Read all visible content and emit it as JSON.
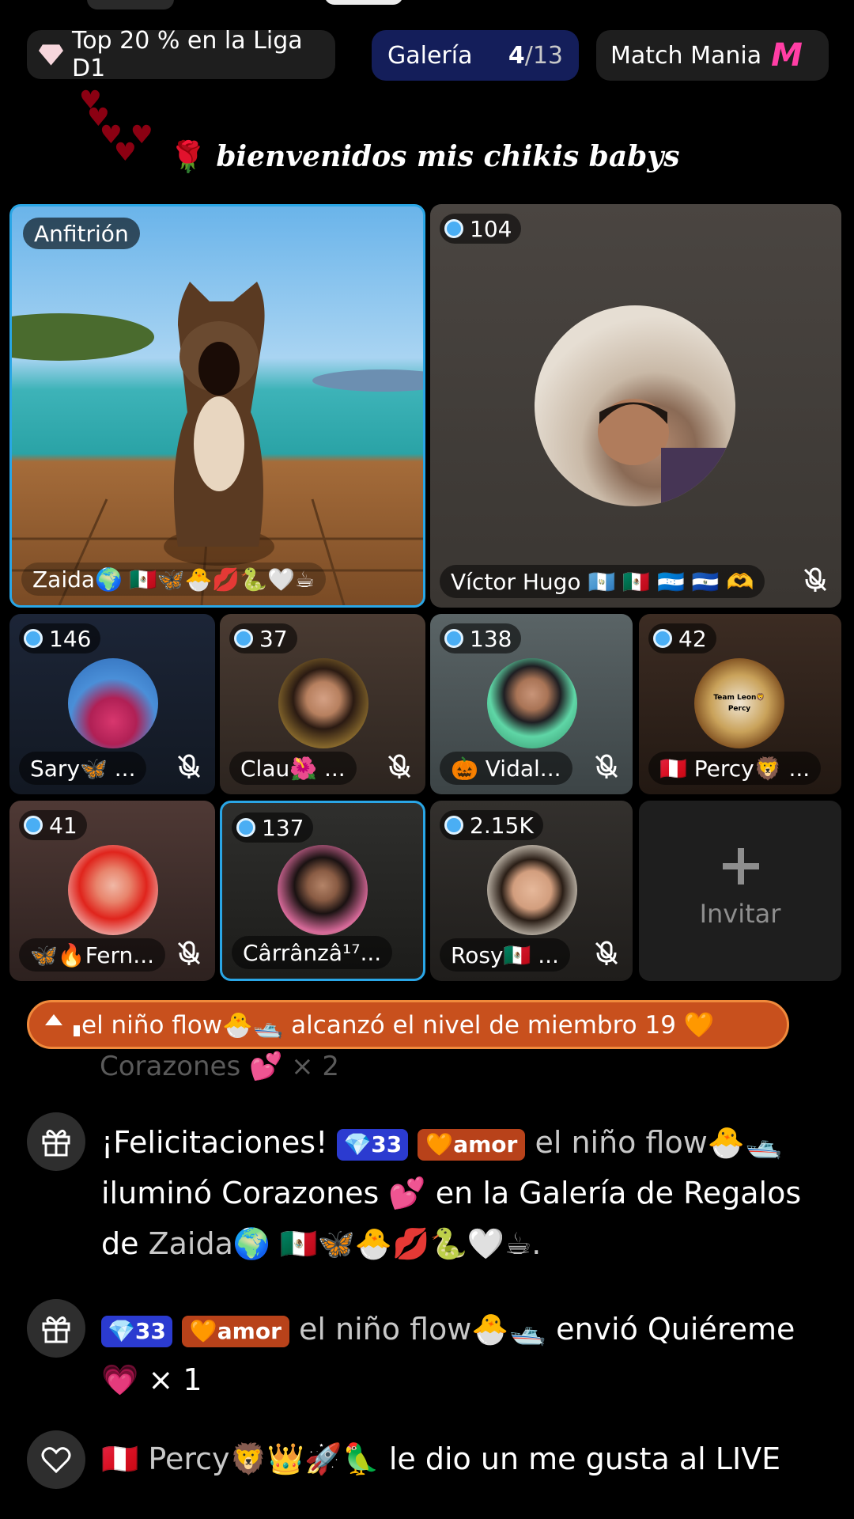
{
  "league": {
    "icon": "diamond-icon",
    "label": "Top 20 % en la Liga D1"
  },
  "gallery": {
    "label": "Galería",
    "current": "4",
    "total": "/13"
  },
  "match_mania": {
    "label": "Match Mania",
    "logo": "M"
  },
  "welcome": {
    "text": "bienvenidos mis chikis babys"
  },
  "tiles": [
    {
      "role": "Anfitrión",
      "name": "Zaida🌍 🇲🇽🦋🐣💋🐍🤍☕"
    },
    {
      "count": "104",
      "name": "Víctor Hugo 🇬🇹 🇲🇽 🇭🇳 🇸🇻 🫶"
    },
    {
      "count": "146",
      "name": "Sary🦋 ..."
    },
    {
      "count": "37",
      "name": "Clau🌺 ..."
    },
    {
      "count": "138",
      "name": "🎃 Vidal..."
    },
    {
      "count": "42",
      "name": "🇵🇪 Percy🦁 ...",
      "avatar_text": "Team Leon🦁\nPercy"
    },
    {
      "count": "41",
      "name": "🦋🔥Fern..."
    },
    {
      "count": "137",
      "name": "Cârrânzâ¹⁷..."
    },
    {
      "count": "2.15K",
      "name": "Rosy🇲🇽 ..."
    }
  ],
  "invite": {
    "label": "Invitar"
  },
  "banner": {
    "text": "el niño flow🐣🛥️ alcanzó el nivel de miembro 19 🧡"
  },
  "ghost_line": "Corazones 💕 × 2",
  "chat": [
    {
      "icon": "gift-icon",
      "pre": "¡Felicitaciones!",
      "level": "💎33",
      "fan": "🧡amor",
      "user": "el niño flow🐣🛥️",
      "body": "iluminó Corazones 💕 en la Galería de Regalos de ",
      "user2": "Zaida🌍 🇲🇽🦋🐣💋🐍🤍☕."
    },
    {
      "icon": "gift-icon",
      "level": "💎33",
      "fan": "🧡amor",
      "user": "el niño flow🐣🛥️",
      "body": "envió Quiéreme 💗 × 1"
    },
    {
      "icon": "heart-icon",
      "user": "🇵🇪 Percy🦁👑🚀🦜",
      "body": "le dio un me gusta al LIVE"
    }
  ]
}
